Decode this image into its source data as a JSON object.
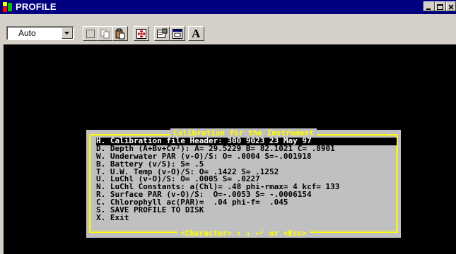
{
  "window": {
    "title": "PROFILE",
    "icon": "app-icon",
    "controls": [
      "minimize-icon",
      "maximize-icon",
      "close-icon"
    ]
  },
  "toolbar": {
    "font_select_value": "Auto",
    "buttons": [
      "mark-icon",
      "copy-icon",
      "paste-icon",
      "fullscreen-icon",
      "properties-icon",
      "background-icon",
      "font-icon"
    ],
    "font_button_label": "A"
  },
  "dialog": {
    "title": "Calibration for the Instrument",
    "footer": "<Character> ↑ ↓ ←┘ or <Esc>",
    "selected_index": 0,
    "items": [
      "H. Calibration file Header: 300 9023 23 May 97",
      "D. Depth (A+Bv+Cv²): A= 29.5229 B= 82.1021 C= .8901",
      "W. Underwater PAR (v-O)/S: O= .0004 S=-.001918",
      "B. Battery (v/S): S= .5",
      "T. U.W. Temp (v-O)/S: O= .1422 S= .1252",
      "U. LuChl (v-O)/S: O= .0005 S= .0227",
      "N. LuChl Constants: a(Chl)= .48 phi-rmax= 4 kcf= 133",
      "R. Surface PAR (v-O)/S:  O=-.0053 S= -.0006154",
      "C. Chlorophyll ac(PAR)=  .04 phi-f=  .045",
      "S. SAVE PROFILE TO DISK",
      "X. Exit"
    ]
  },
  "colors": {
    "titlebar": "#000080",
    "console_bg": "#000000",
    "dialog_bg": "#c0c0c0",
    "dialog_frame": "#ffff00",
    "selection_bg": "#000000"
  }
}
